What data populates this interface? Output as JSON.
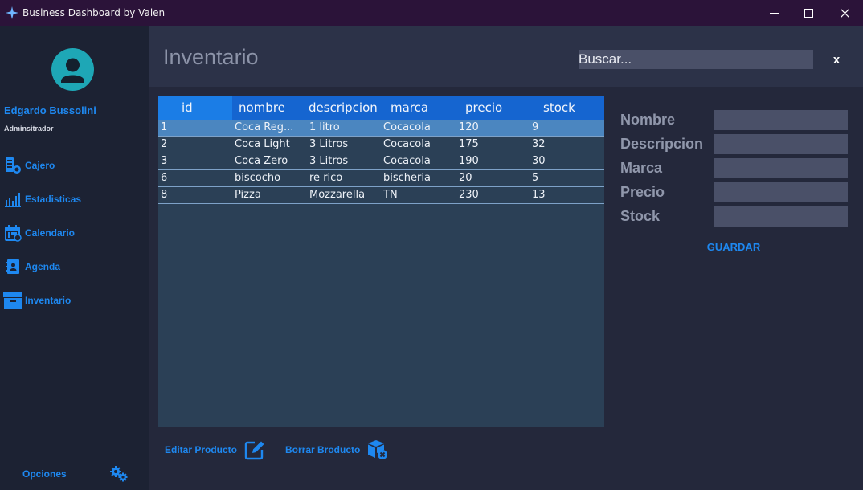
{
  "window": {
    "title": "Business Dashboard by Valen",
    "icons": {
      "app": "sparkle-icon",
      "minimize": "minimize-icon",
      "maximize": "maximize-icon",
      "close": "close-icon"
    }
  },
  "sidebar": {
    "user": {
      "name": "Edgardo Bussolini",
      "role": "Adminsitrador",
      "avatar_icon": "user-avatar-icon"
    },
    "items": [
      {
        "label": "Cajero",
        "icon": "cash-register-icon"
      },
      {
        "label": "Estadisticas",
        "icon": "bar-chart-icon"
      },
      {
        "label": "Calendario",
        "icon": "calendar-icon"
      },
      {
        "label": "Agenda",
        "icon": "contact-book-icon"
      },
      {
        "label": "Inventario",
        "icon": "archive-box-icon"
      }
    ],
    "options_label": "Opciones",
    "options_icon": "gears-icon"
  },
  "header": {
    "title": "Inventario",
    "search_value": "Buscar...",
    "clear_label": "x"
  },
  "table": {
    "columns": [
      "id",
      "nombre",
      "descripcion",
      "marca",
      "precio",
      "stock"
    ],
    "rows": [
      {
        "id": "1",
        "nombre": "Coca Reg...",
        "descripcion": "1 litro",
        "marca": "Cocacola",
        "precio": "120",
        "stock": "9"
      },
      {
        "id": "2",
        "nombre": "Coca Light",
        "descripcion": "3 Litros",
        "marca": "Cocacola",
        "precio": "175",
        "stock": "32"
      },
      {
        "id": "3",
        "nombre": "Coca Zero",
        "descripcion": "3 Litros",
        "marca": "Cocacola",
        "precio": "190",
        "stock": "30"
      },
      {
        "id": "6",
        "nombre": "biscocho",
        "descripcion": "re rico",
        "marca": "bischeria",
        "precio": "20",
        "stock": "5"
      },
      {
        "id": "8",
        "nombre": "Pizza",
        "descripcion": "Mozzarella",
        "marca": "TN",
        "precio": "230",
        "stock": "13"
      }
    ],
    "selected_row": 0
  },
  "form": {
    "labels": {
      "nombre": "Nombre",
      "descripcion": "Descripcion",
      "marca": "Marca",
      "precio": "Precio",
      "stock": "Stock"
    },
    "save_label": "GUARDAR"
  },
  "actions": {
    "edit_label": "Editar Producto",
    "edit_icon": "edit-icon",
    "delete_label": "Borrar Broducto",
    "delete_icon": "delete-box-icon"
  },
  "colors": {
    "accent": "#1e88f0",
    "titlebar": "#2b1339",
    "sidebar": "#1c2233",
    "header": "#2c3248",
    "table_bg": "#2b4056",
    "table_header": "#1565d0",
    "selected_row": "#4b86c0"
  }
}
